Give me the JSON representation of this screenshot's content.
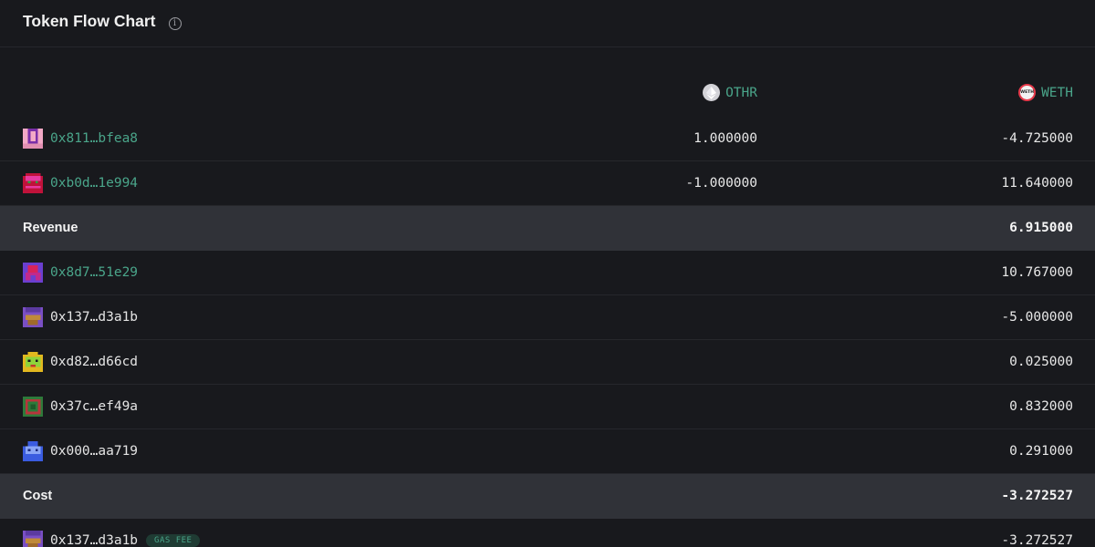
{
  "header": {
    "title": "Token Flow Chart",
    "info_glyph": "i"
  },
  "columns": {
    "othr": {
      "label": "OTHR",
      "icon": "ether-icon"
    },
    "weth": {
      "label": "WETH",
      "icon": "weth-icon",
      "icon_text": "WETH"
    }
  },
  "rows": {
    "r0": {
      "address": "0x811…bfea8",
      "othr": "1.000000",
      "weth": "-4.725000"
    },
    "r1": {
      "address": "0xb0d…1e994",
      "othr": "-1.000000",
      "weth": "11.640000"
    },
    "revenue": {
      "label": "Revenue",
      "weth": "6.915000"
    },
    "r2": {
      "address": "0x8d7…51e29",
      "weth": "10.767000"
    },
    "r3": {
      "address": "0x137…d3a1b",
      "weth": "-5.000000"
    },
    "r4": {
      "address": "0xd82…d66cd",
      "weth": "0.025000"
    },
    "r5": {
      "address": "0x37c…ef49a",
      "weth": "0.832000"
    },
    "r6": {
      "address": "0x000…aa719",
      "weth": "0.291000"
    },
    "cost": {
      "label": "Cost",
      "weth": "-3.272527"
    },
    "r7": {
      "address": "0x137…d3a1b",
      "badge": "GAS FEE",
      "weth": "-3.272527"
    }
  },
  "colors": {
    "background": "#18191d",
    "section_bg": "#303238",
    "link": "#4aa58a",
    "divider": "#26272c"
  }
}
